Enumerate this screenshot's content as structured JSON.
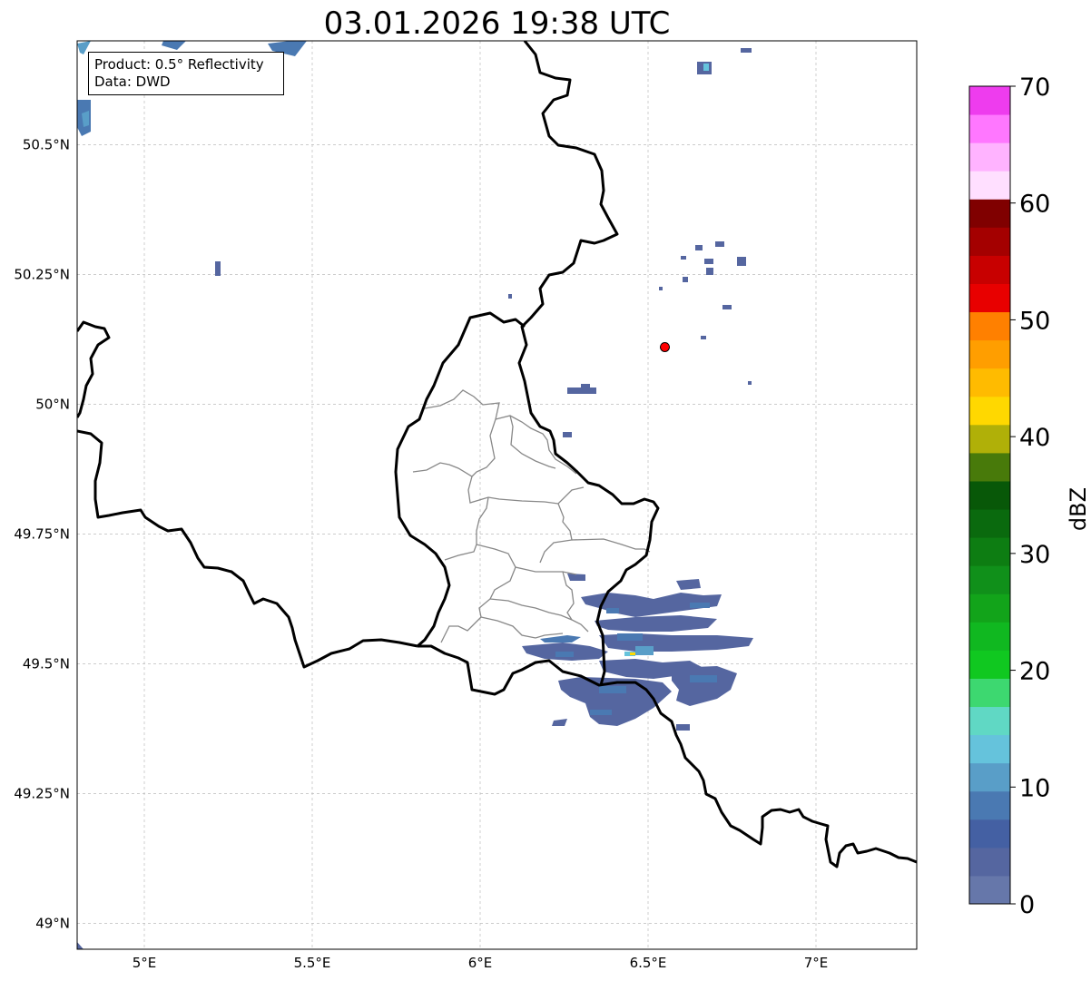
{
  "title": "03.01.2026 19:38 UTC",
  "info_box": {
    "product": "Product: 0.5° Reflectivity",
    "data": "Data: DWD"
  },
  "map": {
    "extent": {
      "lon_min": 4.8,
      "lon_max": 7.3,
      "lat_min": 48.95,
      "lat_max": 50.7
    },
    "lon_ticks": [
      {
        "value": 5.0,
        "label": "5°E"
      },
      {
        "value": 5.5,
        "label": "5.5°E"
      },
      {
        "value": 6.0,
        "label": "6°E"
      },
      {
        "value": 6.5,
        "label": "6.5°E"
      },
      {
        "value": 7.0,
        "label": "7°E"
      }
    ],
    "lat_ticks": [
      {
        "value": 50.5,
        "label": "50.5°N"
      },
      {
        "value": 50.25,
        "label": "50.25°N"
      },
      {
        "value": 50.0,
        "label": "50°N"
      },
      {
        "value": 49.75,
        "label": "49.75°N"
      },
      {
        "value": 49.5,
        "label": "49.5°N"
      },
      {
        "value": 49.25,
        "label": "49.25°N"
      },
      {
        "value": 49.0,
        "label": "49°N"
      }
    ],
    "gridlines": true,
    "radar_site": {
      "lon": 6.55,
      "lat": 50.11,
      "color": "#ff0000"
    }
  },
  "colorbar": {
    "label": "dBZ",
    "min": 0,
    "max": 70,
    "tick_labels": [
      "0",
      "10",
      "20",
      "30",
      "40",
      "50",
      "60",
      "70"
    ],
    "colors": [
      "#6677aa",
      "#5566a0",
      "#4460a3",
      "#4a79b2",
      "#599ec8",
      "#65c3dc",
      "#60d8c4",
      "#3dd870",
      "#10c820",
      "#10b820",
      "#12a41a",
      "#10901a",
      "#0d7d12",
      "#0a6a0e",
      "#085808",
      "#487a0a",
      "#b0b008",
      "#ffd800",
      "#ffbb00",
      "#ff9e00",
      "#ff8000",
      "#e80000",
      "#c80000",
      "#a40000",
      "#800000",
      "#ffdfff",
      "#ffb3ff",
      "#ff77ff",
      "#ee3cee"
    ]
  }
}
